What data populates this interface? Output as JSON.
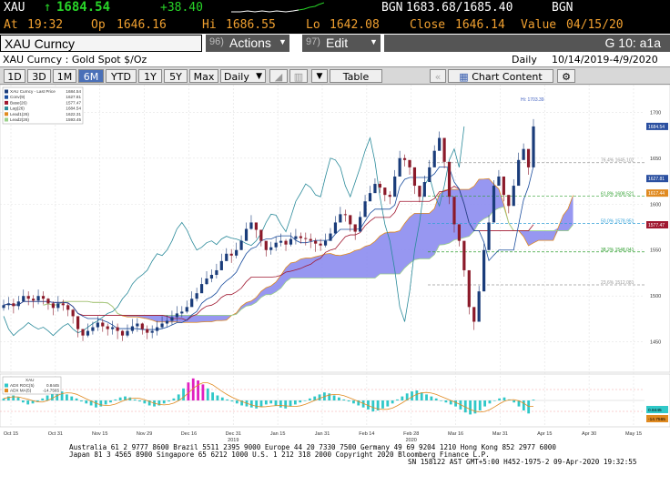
{
  "quote": {
    "ticker": "XAU",
    "arrow": "↑",
    "last": "1684.54",
    "change": "+38.40",
    "bid_ask_label": "BGN",
    "bid_ask": "1683.68/1685.40",
    "bid_ask_src": "BGN"
  },
  "stats": {
    "at_label": "At",
    "at": "19:32",
    "op_label": "Op",
    "op": "1646.16",
    "hi_label": "Hi",
    "hi": "1686.55",
    "lo_label": "Lo",
    "lo": "1642.08",
    "close_label": "Close",
    "close": "1646.14",
    "value_label": "Value",
    "value": "04/15/20"
  },
  "security_bar": {
    "name": "XAU Curncy",
    "actions_num": "96)",
    "actions_label": "Actions",
    "edit_num": "97)",
    "edit_label": "Edit",
    "page": "G 10: a1a"
  },
  "subtitle": {
    "security": "XAU Curncy : Gold Spot   $/Oz",
    "period_label": "Daily",
    "range": "10/14/2019-4/9/2020"
  },
  "toolbar": {
    "periods": [
      "1D",
      "3D",
      "1M",
      "6M",
      "YTD",
      "1Y",
      "5Y",
      "Max"
    ],
    "active_period": "6M",
    "frequency": "Daily",
    "table_label": "Table",
    "chart_content_label": "Chart Content"
  },
  "colors": {
    "candle_up": "#1a3c7a",
    "candle_down": "#8b1a2a",
    "cloud": "#8c8cf0",
    "conv": "#1a4d9e",
    "base": "#a01830",
    "lag": "#2a8a9a",
    "lead1": "#e08a20",
    "lead2": "#9ad08a",
    "highlight": "#e020c0",
    "signal": "#30c8c8"
  },
  "chart_data": {
    "type": "line",
    "legend": [
      {
        "name": "XAU Curncy - Last Price",
        "value": "1684.54"
      },
      {
        "name": "Conv(9)",
        "value": "1627.81"
      },
      {
        "name": "Base(26)",
        "value": "1577.47"
      },
      {
        "name": "Lag(26)",
        "value": "1684.54"
      },
      {
        "name": "Lead1(26)",
        "value": "1622.31"
      },
      {
        "name": "Lead2(26)",
        "value": "1593.45"
      }
    ],
    "hi_marker": "Hi: 1703.39",
    "y_ticks": [
      1450,
      1500,
      1550,
      1600,
      1650,
      1700
    ],
    "y_range": [
      1420,
      1730
    ],
    "x_ticks": [
      "Oct 15",
      "Oct 31",
      "Nov 15",
      "Nov 29",
      "Dec 16",
      "Dec 31",
      "Jan 15",
      "Jan 31",
      "Feb 14",
      "Feb 28",
      "Mar 16",
      "Mar 31",
      "Apr 15",
      "Apr 30",
      "May 15"
    ],
    "x_year_labels": [
      {
        "at": "Dec 31",
        "label": "2019"
      },
      {
        "at": "Feb 28",
        "label": "2020"
      }
    ],
    "fib_levels": [
      {
        "label": "76.4% 1645.102",
        "value": 1645.1
      },
      {
        "label": "61.8% 1608.521",
        "value": 1608.5
      },
      {
        "label": "50.0% 1578.951",
        "value": 1578.95
      },
      {
        "label": "38.2% 1548.041",
        "value": 1548.0
      },
      {
        "label": "23.6% 1512.081",
        "value": 1512.1
      }
    ],
    "price_tags": [
      {
        "value": "1684.54",
        "y": 1684.54
      },
      {
        "value": "1627.81",
        "y": 1627.81
      },
      {
        "value": "1617.44",
        "y": 1612.0
      },
      {
        "value": "1577.47",
        "y": 1577.47
      }
    ],
    "close": [
      1490,
      1492,
      1489,
      1494,
      1500,
      1497,
      1495,
      1500,
      1497,
      1492,
      1487,
      1492,
      1490,
      1485,
      1478,
      1464,
      1457,
      1462,
      1466,
      1471,
      1467,
      1464,
      1466,
      1462,
      1457,
      1462,
      1467,
      1470,
      1464,
      1460,
      1462,
      1466,
      1470,
      1473,
      1477,
      1481,
      1483,
      1488,
      1497,
      1503,
      1513,
      1519,
      1523,
      1528,
      1538,
      1546,
      1544,
      1550,
      1560,
      1573,
      1580,
      1572,
      1560,
      1550,
      1553,
      1558,
      1560,
      1556,
      1562,
      1565,
      1563,
      1562,
      1560,
      1557,
      1555,
      1560,
      1568,
      1580,
      1589,
      1588,
      1578,
      1570,
      1586,
      1603,
      1612,
      1622,
      1618,
      1610,
      1608,
      1630,
      1650,
      1648,
      1640,
      1620,
      1608,
      1624,
      1640,
      1658,
      1672,
      1646,
      1608,
      1578,
      1560,
      1528,
      1488,
      1472,
      1505,
      1550,
      1580,
      1620,
      1630,
      1610,
      1598,
      1620,
      1648,
      1660,
      1640,
      1684.54
    ]
  },
  "indicator": {
    "title": "XAU",
    "legend": [
      {
        "name": "ADX ROC(5)",
        "value": "0.8445"
      },
      {
        "name": "ADX MA(5)",
        "value": "-14.7565"
      }
    ],
    "tags": [
      "0.8445",
      "-14.7565"
    ],
    "values": [
      2,
      4,
      5,
      3,
      -2,
      -4,
      -3,
      -1,
      2,
      5,
      8,
      10,
      9,
      6,
      4,
      2,
      -1,
      -3,
      -5,
      -7,
      -6,
      -4,
      -2,
      1,
      3,
      4,
      3,
      1,
      -1,
      -3,
      -5,
      -6,
      -5,
      -3,
      -1,
      2,
      6,
      12,
      18,
      22,
      20,
      16,
      12,
      8,
      5,
      3,
      1,
      -1,
      -3,
      -5,
      -6,
      -7,
      -8,
      -6,
      -4,
      -3,
      -5,
      -7,
      -8,
      -6,
      -4,
      -2,
      0,
      2,
      4,
      6,
      8,
      7,
      5,
      3,
      1,
      -1,
      -3,
      -5,
      -7,
      -9,
      -11,
      -10,
      -8,
      -6,
      -3,
      1,
      4,
      7,
      9,
      10,
      8,
      6,
      4,
      2,
      0,
      -2,
      -4,
      -6,
      -9,
      -12,
      -14,
      -13,
      -10,
      -6,
      -3,
      0,
      2,
      3,
      1,
      -2,
      -6,
      -10,
      -13,
      0.84
    ]
  },
  "footer": {
    "line1": "Australia 61 2 9777 8600  Brazil 5511 2395 9000  Europe 44 20 7330 7500  Germany 49 69 9204 1210  Hong Kong 852 2977 6000",
    "line2": "Japan 81 3 4565 8900       Singapore 65 6212 1000       U.S. 1 212 318 2000          Copyright 2020 Bloomberg Finance L.P.",
    "line3": "SN 158122 AST  GMT+5:00 H452-1975-2 09-Apr-2020 19:32:55"
  }
}
